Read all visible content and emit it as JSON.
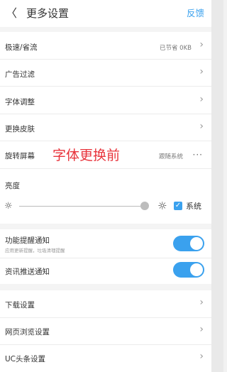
{
  "header": {
    "back_glyph": "〈",
    "title": "更多设置",
    "feedback": "反馈"
  },
  "rows": {
    "speed": {
      "label": "极速/省流",
      "value": "已节省 0KB"
    },
    "adblock": {
      "label": "广告过滤"
    },
    "font": {
      "label": "字体调整"
    },
    "skin": {
      "label": "更换皮肤"
    },
    "rotate": {
      "label": "旋转屏幕",
      "note": "字体更换前",
      "value": "跟随系统",
      "more_glyph": "···"
    }
  },
  "brightness": {
    "label": "亮度",
    "sun_glyph": "☼",
    "level": 0.95,
    "system_checked": true,
    "system_label": "系统",
    "check_glyph": "✓"
  },
  "notifications": {
    "feature": {
      "label": "功能提醒通知",
      "sub": "应用更新提醒，垃圾清理提醒",
      "on": true
    },
    "news": {
      "label": "资讯推送通知",
      "on": true
    }
  },
  "more": {
    "download": {
      "label": "下载设置"
    },
    "browse": {
      "label": "网页浏览设置"
    },
    "uc_news": {
      "label": "UC头条设置"
    }
  },
  "chevron_glyph": "›",
  "colors": {
    "accent": "#3aa1ee",
    "note": "#e8343c"
  }
}
